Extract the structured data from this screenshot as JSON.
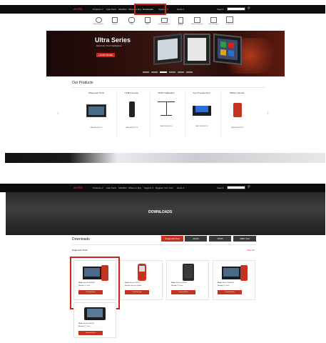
{
  "top_screen": {
    "nav": {
      "brand": "AUTEL",
      "links": [
        "Products ∨",
        "Auto Parts",
        "OE/OES",
        "Where to Buy",
        "Downloads",
        "Support ∨",
        "News ∨"
      ],
      "highlighted_index": 4,
      "search": "Search"
    },
    "icon_menu": [
      "Auto Diagnostic",
      "Service",
      "TPMS",
      "ADAS",
      "Key Programming",
      "Battery",
      "Remote Diagnosis",
      "Smart Manager",
      "Oscilloscope"
    ],
    "hero": {
      "title": "Ultra Series",
      "subtitle": "Maximize Your Intelligence",
      "button": "LEARN MORE"
    },
    "products": {
      "heading": "Our Products",
      "items": [
        {
          "name": "Diagnostic Tools",
          "link": "VIEW PRODUCTS"
        },
        {
          "name": "TPMS Service",
          "link": "VIEW PRODUCTS"
        },
        {
          "name": "ADAS Calibration",
          "link": "VIEW PRODUCTS"
        },
        {
          "name": "Key Programming",
          "link": "VIEW PRODUCTS"
        },
        {
          "name": "Battery Service",
          "link": "VIEW PRODUCTS"
        }
      ]
    }
  },
  "bottom_screen": {
    "nav": {
      "brand": "AUTEL",
      "links": [
        "Products ∨",
        "Auto Parts",
        "OE/OES",
        "Where to Buy",
        "Support ∨",
        "Register Your Tool",
        "News ∨"
      ],
      "search": "Search"
    },
    "banner_title": "DOWNLOADS",
    "section_title": "Downloads",
    "tabs": [
      "Diagnostic Tool",
      "ADAS",
      "TPMS",
      "OBD/ Tool"
    ],
    "subsection": "Diagnostic Tools",
    "view_all": "View all",
    "cards": [
      {
        "model_label": "Model:",
        "model": "MaxiCOM MK808",
        "version_label": "Version:",
        "version": "PC Suite",
        "button": "Download Now"
      },
      {
        "model_label": "Model:",
        "model": "MaxiLink ML629",
        "version_label": "Version:",
        "version": "MaxiLink Update",
        "button": "Download Now"
      },
      {
        "model_label": "Model:",
        "model": "MaxiSys MS906",
        "version_label": "Version:",
        "version": "PC Suite",
        "button": "Download Now"
      },
      {
        "model_label": "Model:",
        "model": "MaxiCOM MK906",
        "version_label": "Version:",
        "version": "PC Suite",
        "button": "Download Now"
      },
      {
        "model_label": "Model:",
        "model": "MaxiSys MS908",
        "version_label": "Version:",
        "version": "PC Suite",
        "button": "Download Now"
      }
    ]
  },
  "colors": {
    "accent_red": "#d0231b",
    "nav_bg": "#0d0d0d",
    "button_red": "#c4331f"
  }
}
